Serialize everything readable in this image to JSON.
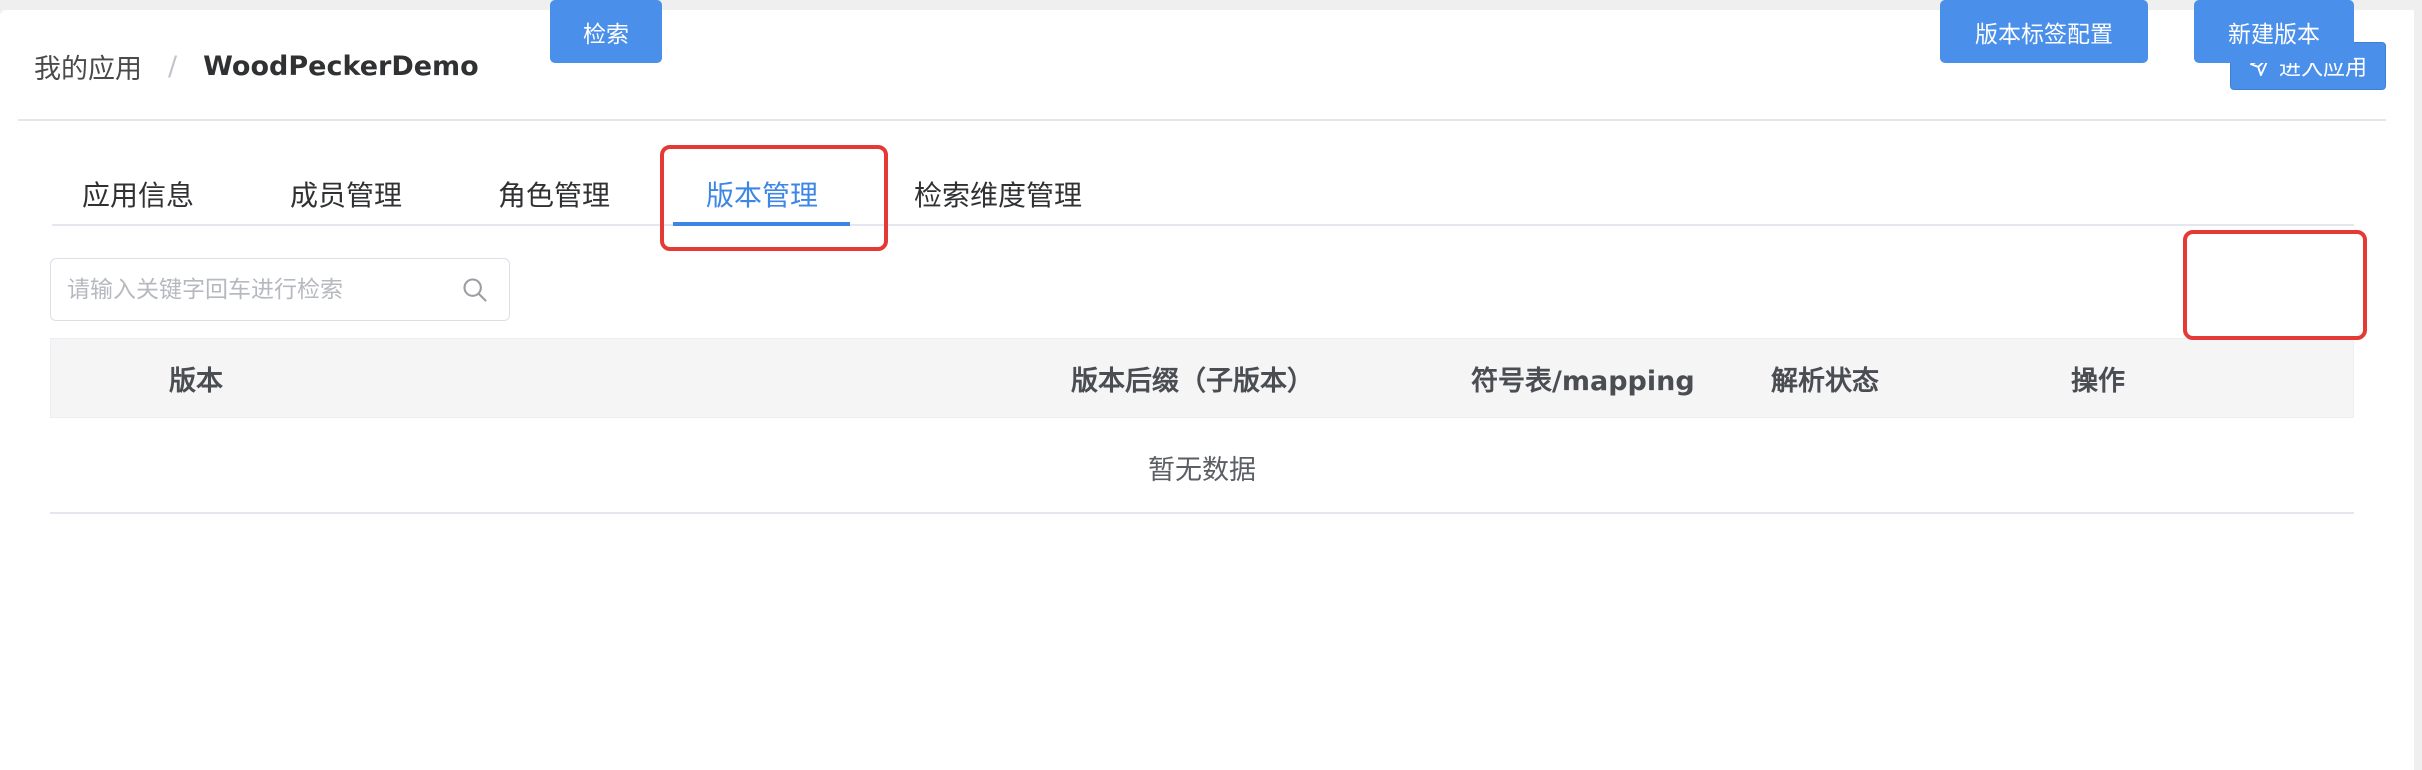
{
  "breadcrumb": {
    "root": "我的应用",
    "separator": "/",
    "current": "WoodPeckerDemo"
  },
  "header": {
    "enter_app_label": "进入应用"
  },
  "tabs": [
    {
      "label": "应用信息",
      "active": false
    },
    {
      "label": "成员管理",
      "active": false
    },
    {
      "label": "角色管理",
      "active": false
    },
    {
      "label": "版本管理",
      "active": true
    },
    {
      "label": "检索维度管理",
      "active": false
    }
  ],
  "toolbar": {
    "search_placeholder": "请输入关键字回车进行检索",
    "search_value": "",
    "search_button": "检索",
    "tag_config_button": "版本标签配置",
    "new_version_button": "新建版本"
  },
  "table": {
    "columns": [
      "版本",
      "版本后缀（子版本）",
      "符号表/mapping",
      "解析状态",
      "操作"
    ],
    "empty_text": "暂无数据"
  },
  "icons": {
    "enter_app": "paper-plane-icon",
    "search": "search-icon"
  },
  "colors": {
    "primary": "#4a8fea",
    "active_tab": "#3d86e6",
    "highlight": "#e53935"
  }
}
